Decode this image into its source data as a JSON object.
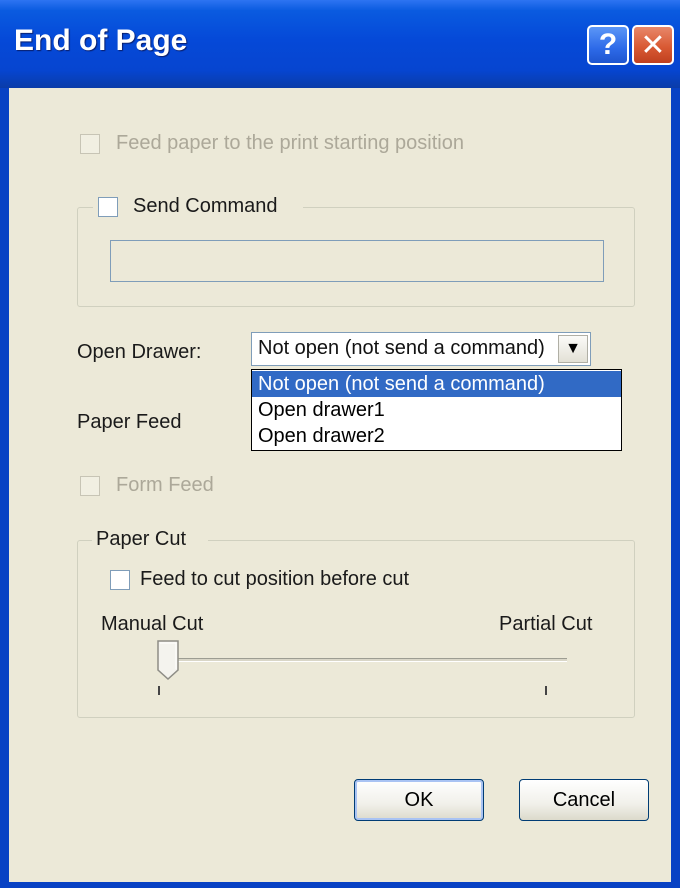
{
  "window": {
    "title": "End of Page",
    "help_label": "?",
    "close_label": "✕"
  },
  "feed_paper": {
    "label": "Feed paper to the print starting position",
    "checked": false,
    "enabled": false
  },
  "send_command": {
    "label": "Send Command",
    "checked": false,
    "value": ""
  },
  "open_drawer": {
    "label": "Open Drawer:",
    "selected": "Not open (not send a command)",
    "options": [
      "Not open (not send a command)",
      "Open drawer1",
      "Open drawer2"
    ]
  },
  "paper_feed": {
    "label": "Paper Feed"
  },
  "form_feed": {
    "label": "Form Feed",
    "checked": false,
    "enabled": false
  },
  "paper_cut": {
    "legend": "Paper Cut",
    "feed_label": "Feed to cut position before cut",
    "min_label": "Manual Cut",
    "max_label": "Partial Cut",
    "slider_value": 0
  },
  "buttons": {
    "ok": "OK",
    "cancel": "Cancel"
  },
  "colors": {
    "titlebar": "#0549D8",
    "face": "#ECE9D8",
    "selection": "#316AC5",
    "disabled_text": "#ACA899"
  }
}
